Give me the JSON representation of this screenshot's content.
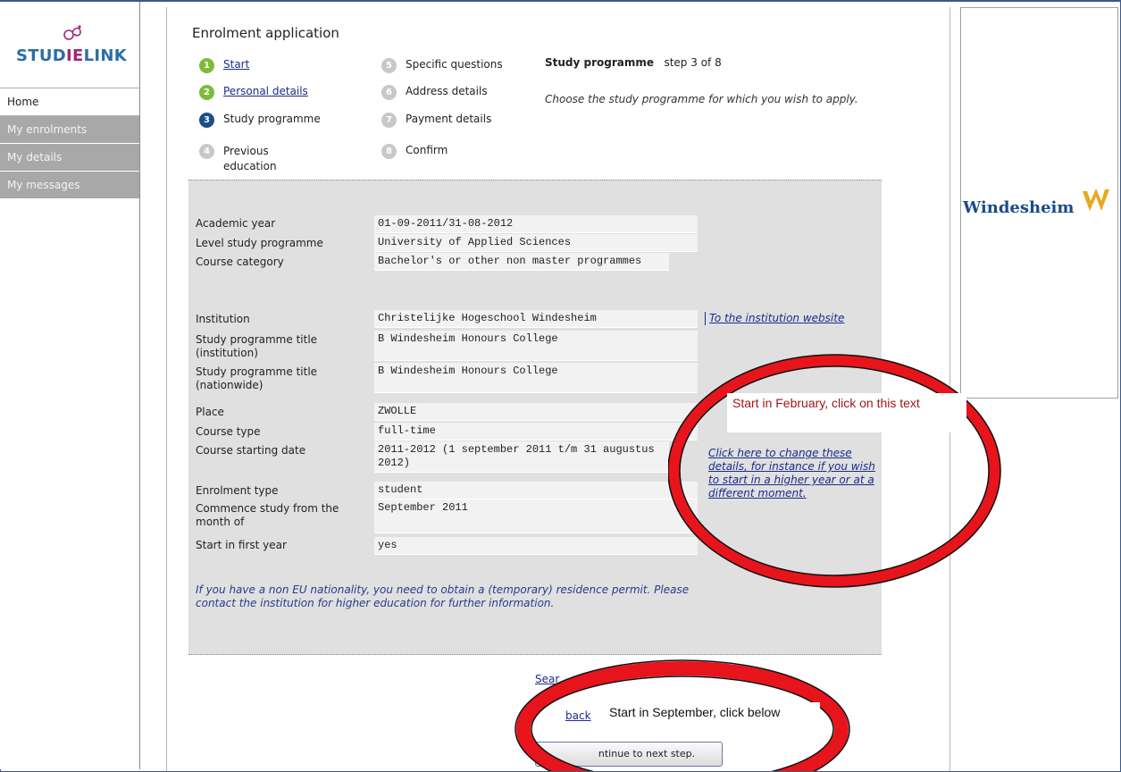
{
  "sidebar": {
    "logo_text_a": "STUD",
    "logo_text_b": "IE",
    "logo_text_c": "LINK",
    "items": [
      {
        "label": "Home"
      },
      {
        "label": "My enrolments"
      },
      {
        "label": "My details"
      },
      {
        "label": "My messages"
      }
    ]
  },
  "main": {
    "title": "Enrolment application",
    "steps": [
      {
        "num": "1",
        "label": "Start"
      },
      {
        "num": "2",
        "label": "Personal details"
      },
      {
        "num": "3",
        "label": "Study programme"
      },
      {
        "num": "4",
        "label": "Previous education"
      },
      {
        "num": "5",
        "label": "Specific questions"
      },
      {
        "num": "6",
        "label": "Address details"
      },
      {
        "num": "7",
        "label": "Payment details"
      },
      {
        "num": "8",
        "label": "Confirm"
      }
    ],
    "step_title": "Study programme",
    "step_counter": "step 3 of 8",
    "step_description": "Choose the study programme for which you wish to apply."
  },
  "form": {
    "fields": [
      {
        "label": "Academic year",
        "value": "01-09-2011/31-08-2012"
      },
      {
        "label": "Level study programme",
        "value": "University of Applied Sciences"
      },
      {
        "label": "Course category",
        "value": "Bachelor's or other non master programmes"
      },
      {
        "label": "Institution",
        "value": "Christelijke Hogeschool Windesheim"
      },
      {
        "label": "Study programme title (institution)",
        "value": "B Windesheim Honours College"
      },
      {
        "label": "Study programme title (nationwide)",
        "value": "B Windesheim Honours College"
      },
      {
        "label": "Place",
        "value": "ZWOLLE"
      },
      {
        "label": "Course type",
        "value": "full-time"
      },
      {
        "label": "Course starting date",
        "value": "2011-2012 (1 september 2011 t/m 31 augustus 2012)"
      },
      {
        "label": "Enrolment type",
        "value": "student"
      },
      {
        "label": "Commence study from the month of",
        "value": "September 2011"
      },
      {
        "label": "Start in first year",
        "value": "yes"
      }
    ],
    "institution_link": "To the institution website",
    "change_link": "Click here to change these details, for instance if you wish to start in a higher year or at a different moment.",
    "note": "If you have a non EU nationality, you need to obtain a (temporary) residence permit. Please contact the institution for higher education for further information."
  },
  "footer": {
    "search_link": "Sear",
    "back_link": "back",
    "next_button": "ntinue to next step."
  },
  "right": {
    "brand": "Windesheim"
  },
  "annotations": {
    "february": "Start in February, click on this text",
    "september": "Start in September, click below"
  },
  "colors": {
    "accent_red": "#e8141c",
    "link_blue": "#1a2b8c",
    "panel_gray": "#e0e0e0",
    "step_green": "#7dbb3c",
    "step_blue": "#1c4f8a"
  }
}
